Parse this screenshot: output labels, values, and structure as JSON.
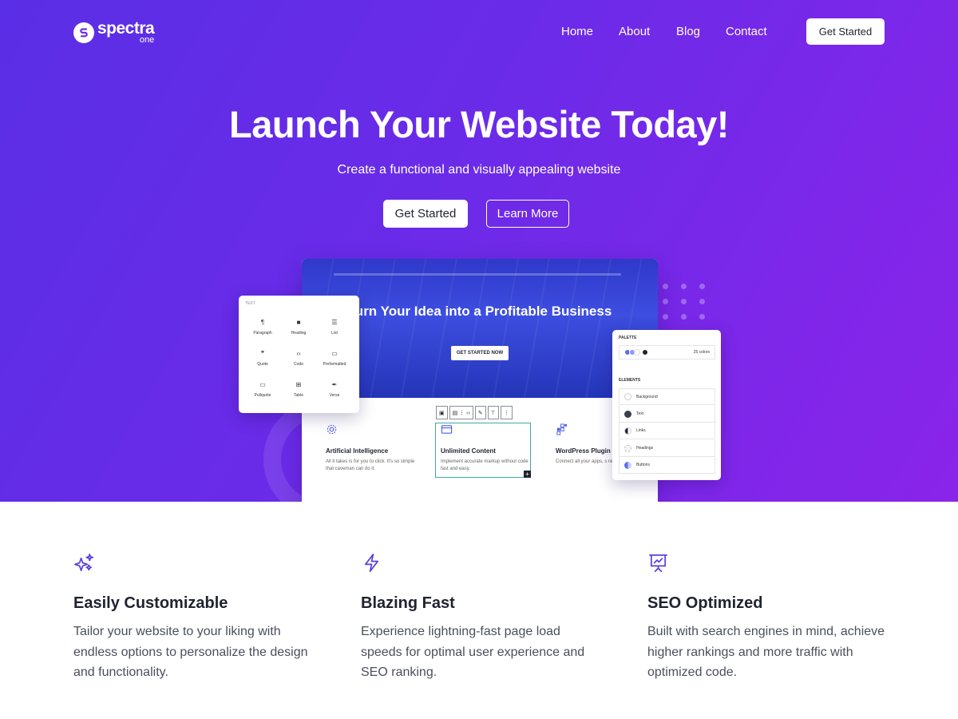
{
  "brand": {
    "name": "spectra",
    "sub": "one"
  },
  "nav": {
    "items": [
      "Home",
      "About",
      "Blog",
      "Contact"
    ],
    "cta": "Get Started"
  },
  "hero": {
    "title": "Launch Your Website Today!",
    "subtitle": "Create a functional and visually appealing website",
    "primary_button": "Get Started",
    "secondary_button": "Learn More"
  },
  "mockup": {
    "hero_title": "Turn Your Idea into a Profitable Business",
    "hero_button": "GET STARTED NOW",
    "features": [
      {
        "icon": "gear-icon",
        "title": "Artificial Intelligence",
        "text": "All it takes is for you to click. It's so simple that caveman can do it."
      },
      {
        "icon": "window-icon",
        "title": "Unlimited Content",
        "text": "Implement accurate markup without code fast and easy."
      },
      {
        "icon": "plugin-icon",
        "title": "WordPress Plugin",
        "text": "Connect all your apps, s repetitive tasks."
      }
    ],
    "blocks_panel": {
      "label": "TEXT",
      "items": [
        {
          "label": "Paragraph",
          "icon": "paragraph-icon"
        },
        {
          "label": "Heading",
          "icon": "bookmark-icon"
        },
        {
          "label": "List",
          "icon": "list-icon"
        },
        {
          "label": "Quote",
          "icon": "quote-icon"
        },
        {
          "label": "Code",
          "icon": "code-icon"
        },
        {
          "label": "Preformatted",
          "icon": "preformatted-icon"
        },
        {
          "label": "Pullquote",
          "icon": "pullquote-icon"
        },
        {
          "label": "Table",
          "icon": "table-icon"
        },
        {
          "label": "Verse",
          "icon": "verse-icon"
        }
      ]
    },
    "palette_panel": {
      "palette_label": "PALETTE",
      "palette_count": "25 colors",
      "elements_label": "ELEMENTS",
      "elements": [
        "Background",
        "Text",
        "Links",
        "Headings",
        "Buttons"
      ]
    }
  },
  "features": [
    {
      "icon": "sparkles-icon",
      "title": "Easily Customizable",
      "text": "Tailor your website to your liking with endless options to personalize the design and functionality."
    },
    {
      "icon": "lightning-icon",
      "title": "Blazing Fast",
      "text": "Experience lightning-fast page load speeds for optimal user experience and SEO ranking."
    },
    {
      "icon": "presentation-chart-icon",
      "title": "SEO Optimized",
      "text": "Built with search engines in mind, achieve higher rankings and more traffic with optimized code."
    }
  ],
  "colors": {
    "hero_gradient_start": "#5a2ee6",
    "hero_gradient_end": "#8a24ea",
    "accent": "#5a3fe0",
    "text_dark": "#1f2330"
  }
}
